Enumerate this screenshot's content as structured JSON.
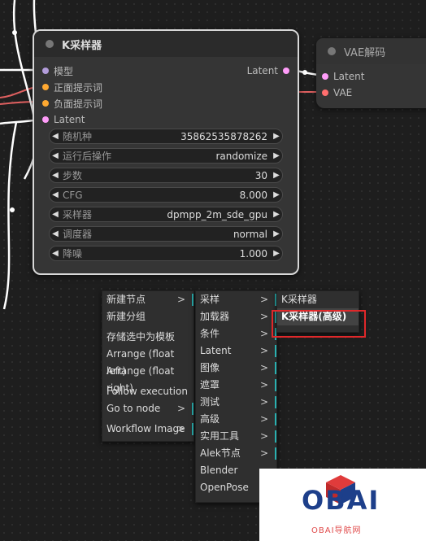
{
  "ksampler": {
    "title": "K采样器",
    "inputs": [
      {
        "label": "模型",
        "color": "#b39ddb"
      },
      {
        "label": "正面提示词",
        "color": "#ffa931"
      },
      {
        "label": "负面提示词",
        "color": "#ffa931"
      },
      {
        "label": "Latent",
        "color": "#ff9cf9"
      }
    ],
    "output": {
      "label": "Latent",
      "color": "#ff9cf9"
    },
    "widgets": [
      {
        "name": "随机种",
        "value": "35862535878262"
      },
      {
        "name": "运行后操作",
        "value": "randomize"
      },
      {
        "name": "步数",
        "value": "30"
      },
      {
        "name": "CFG",
        "value": "8.000"
      },
      {
        "name": "采样器",
        "value": "dpmpp_2m_sde_gpu"
      },
      {
        "name": "调度器",
        "value": "normal"
      },
      {
        "name": "降噪",
        "value": "1.000"
      }
    ]
  },
  "vae_decode": {
    "title": "VAE解码",
    "inputs": [
      {
        "label": "Latent",
        "color": "#ff9cf9"
      },
      {
        "label": "VAE",
        "color": "#ff6e6e"
      }
    ]
  },
  "context_menu": {
    "items": [
      {
        "label": "新建节点",
        "submenu": true
      },
      {
        "label": "新建分组",
        "submenu": false
      },
      {
        "label": "存储选中为模板",
        "submenu": false
      },
      {
        "label": "Arrange (float left)",
        "submenu": false
      },
      {
        "label": "Arrange (float right)",
        "submenu": false
      },
      {
        "label": "Follow execution",
        "submenu": false
      },
      {
        "label": "Go to node",
        "submenu": true
      },
      {
        "label": "Workflow Image",
        "submenu": true
      }
    ]
  },
  "category_menu": {
    "items": [
      {
        "label": "采样",
        "submenu": true
      },
      {
        "label": "加载器",
        "submenu": true
      },
      {
        "label": "条件",
        "submenu": true
      },
      {
        "label": "Latent",
        "submenu": true
      },
      {
        "label": "图像",
        "submenu": true
      },
      {
        "label": "遮罩",
        "submenu": true
      },
      {
        "label": "测试",
        "submenu": true
      },
      {
        "label": "高级",
        "submenu": true
      },
      {
        "label": "实用工具",
        "submenu": true
      },
      {
        "label": "Alek节点",
        "submenu": true
      },
      {
        "label": "Blender",
        "submenu": false
      },
      {
        "label": "OpenPose",
        "submenu": false
      }
    ]
  },
  "sampler_menu": {
    "items": [
      {
        "label": "K采样器",
        "highlighted": false
      },
      {
        "label": "K采样器(高级)",
        "highlighted": true
      }
    ]
  },
  "watermark": {
    "brand": "OBAI",
    "subtitle": "OBAI导航网"
  },
  "colors": {
    "link_white": "#ffffff",
    "link_red": "#e06060",
    "submenu_bar": "#2ab0b0",
    "highlight_box": "#e0282a"
  },
  "icons": [
    "submenu-arrow-icon",
    "left-arrow-icon",
    "right-arrow-icon",
    "cube-logo-icon"
  ]
}
